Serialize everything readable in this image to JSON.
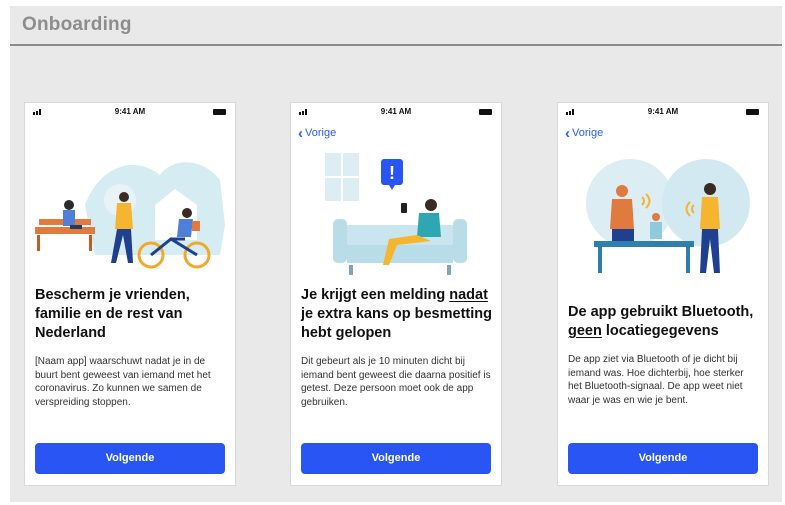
{
  "board": {
    "title": "Onboarding"
  },
  "colors": {
    "accent": "#2a55f5",
    "link": "#2a5bff",
    "board_bg": "#e9e9e9"
  },
  "screens": [
    {
      "status_time": "9:41 AM",
      "back_label": "",
      "illustration": "people-in-park-illustration",
      "title_parts": [
        "Bescherm je vrienden, familie en de rest van Nederland",
        "",
        ""
      ],
      "body": "[Naam app] waarschuwt nadat je in de buurt bent geweest van iemand met het coronavirus. Zo kunnen we samen de verspreiding stoppen.",
      "button": "Volgende"
    },
    {
      "status_time": "9:41 AM",
      "back_label": "Vorige",
      "illustration": "person-on-couch-notification-illustration",
      "title_parts": [
        "Je krijgt een melding ",
        "nadat",
        " je extra kans op besmetting hebt gelopen"
      ],
      "body": "Dit gebeurt als je 10 minuten dicht bij iemand bent geweest die daarna positief is getest. Deze persoon moet ook de app gebruiken.",
      "button": "Volgende"
    },
    {
      "status_time": "9:41 AM",
      "back_label": "Vorige",
      "illustration": "bluetooth-people-illustration",
      "title_parts": [
        "De app gebruikt Bluetooth, ",
        "geen",
        " locatiegegevens"
      ],
      "body": "De app ziet via Bluetooth of je dicht bij iemand was. Hoe dichterbij, hoe sterker het Bluetooth-signaal. De app weet niet waar je was en wie je bent.",
      "button": "Volgende"
    }
  ]
}
